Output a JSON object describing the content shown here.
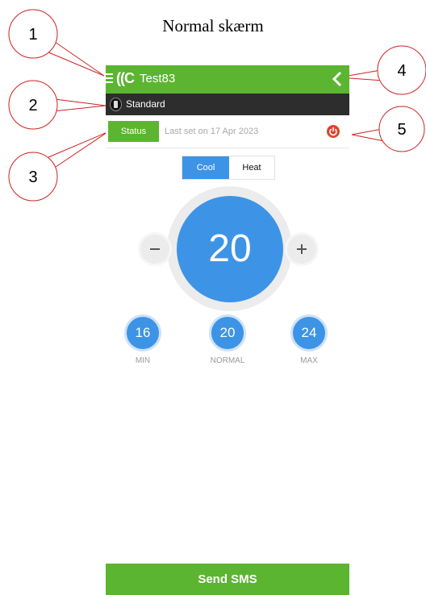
{
  "caption": "Normal skærm",
  "callouts": [
    "1",
    "2",
    "3",
    "4",
    "5"
  ],
  "header": {
    "logo": "((C",
    "title": "Test83"
  },
  "mode": {
    "label": "Standard"
  },
  "status": {
    "button_label": "Status",
    "last_set": "Last set on 17 Apr 2023"
  },
  "toggle": {
    "cool_label": "Cool",
    "heat_label": "Heat",
    "selected": "Cool"
  },
  "thermostat": {
    "current": "20"
  },
  "presets": [
    {
      "value": "16",
      "label": "MIN"
    },
    {
      "value": "20",
      "label": "NORMAL"
    },
    {
      "value": "24",
      "label": "MAX"
    }
  ],
  "footer": {
    "send_label": "Send SMS"
  },
  "colors": {
    "green": "#5cb531",
    "blue": "#3d94e6",
    "dark": "#2d2d2d",
    "callout_red": "#cc2222",
    "power_red": "#e2412b"
  }
}
